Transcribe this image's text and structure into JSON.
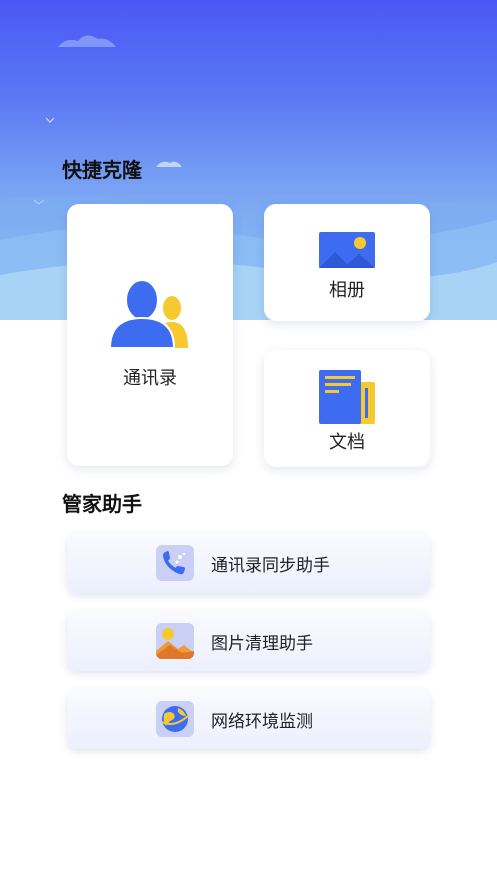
{
  "quick_clone": {
    "title": "快捷克隆",
    "contacts_label": "通讯录",
    "album_label": "相册",
    "docs_label": "文档"
  },
  "butler": {
    "title": "管家助手",
    "items": [
      {
        "label": "通讯录同步助手",
        "icon": "phone-sync-icon"
      },
      {
        "label": "图片清理助手",
        "icon": "image-clean-icon"
      },
      {
        "label": "网络环境监测",
        "icon": "globe-network-icon"
      }
    ]
  },
  "colors": {
    "primary": "#3d6cf0",
    "accent_yellow": "#f7c931",
    "hero_top": "#4a58f5",
    "hero_bottom": "#9fcaf4"
  }
}
